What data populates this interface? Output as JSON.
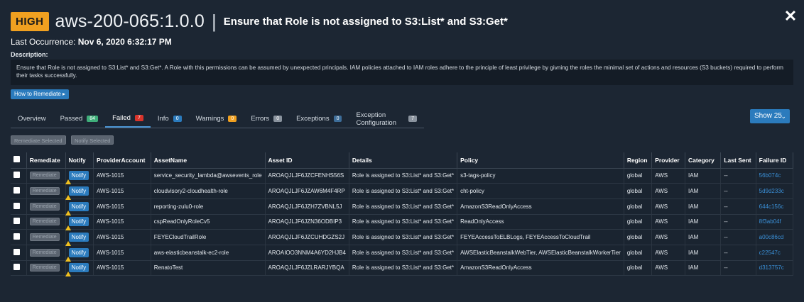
{
  "header": {
    "severity": "HIGH",
    "rule_id": "aws-200-065:1.0.0",
    "separator": "|",
    "title": "Ensure that Role is not assigned to S3:List* and S3:Get*",
    "close_icon": "close-icon",
    "last_occurrence_label": "Last Occurrence:",
    "last_occurrence_value": "Nov 6, 2020 6:32:17 PM"
  },
  "description": {
    "label": "Description:",
    "text": "Ensure that Role is not assigned to S3:List* and S3:Get*. A Role with this permissions can be assumed by unexpected principals. IAM policies attached to IAM roles adhere to the principle of least privilege by givning the roles the minimal set of actions and resources (S3 buckets) required to perform their tasks successfully."
  },
  "how_to_remediate": "How to Remediate ▸",
  "tabs": [
    {
      "label": "Overview",
      "count": "",
      "color": ""
    },
    {
      "label": "Passed",
      "count": "84",
      "color": "#3fae7a"
    },
    {
      "label": "Failed",
      "count": "7",
      "color": "#d9342b"
    },
    {
      "label": "Info",
      "count": "0",
      "color": "#2b7bbd"
    },
    {
      "label": "Warnings",
      "count": "0",
      "color": "#f0a020"
    },
    {
      "label": "Errors",
      "count": "0",
      "color": "#8a939e"
    },
    {
      "label": "Exceptions",
      "count": "0",
      "color": "#3d6d99"
    },
    {
      "label": "Exception Configuration",
      "count": "7",
      "color": "#8a939e"
    }
  ],
  "active_tab": "Failed",
  "show_select": {
    "label": "Show 25",
    "icon": "chevron-down-icon"
  },
  "bulk": {
    "remediate_selected": "Remediate Selected",
    "notify_selected": "Notify Selected"
  },
  "table": {
    "headers": [
      "",
      "Remediate",
      "Notify",
      "ProviderAccount",
      "AssetName",
      "Asset ID",
      "Details",
      "Policy",
      "Region",
      "Provider",
      "Category",
      "Last Sent",
      "Failure ID"
    ],
    "remediate_label": "Remediate",
    "notify_label": "Notify",
    "rows": [
      {
        "account": "AWS-1015",
        "asset_name": "service_security_lambda@awsevents_role",
        "asset_id": "AROAQJLJF6JZCFENHS56S",
        "details": "Role is assigned to S3:List* and S3:Get*",
        "policy": "s3-tags-policy",
        "region": "global",
        "provider": "AWS",
        "category": "IAM",
        "last_sent": "--",
        "failure_id": "56b074c"
      },
      {
        "account": "AWS-1015",
        "asset_name": "cloudvisory2-cloudhealth-role",
        "asset_id": "AROAQJLJF6JZAW6M4F4RP",
        "details": "Role is assigned to S3:List* and S3:Get*",
        "policy": "cht-policy",
        "region": "global",
        "provider": "AWS",
        "category": "IAM",
        "last_sent": "--",
        "failure_id": "5d9d233c"
      },
      {
        "account": "AWS-1015",
        "asset_name": "reporting-zulu0-role",
        "asset_id": "AROAQJLJF6JZH7ZVBNL5J",
        "details": "Role is assigned to S3:List* and S3:Get*",
        "policy": "AmazonS3ReadOnlyAccess",
        "region": "global",
        "provider": "AWS",
        "category": "IAM",
        "last_sent": "--",
        "failure_id": "644c156c"
      },
      {
        "account": "AWS-1015",
        "asset_name": "cspReadOnlyRoleCv5",
        "asset_id": "AROAQJLJF6JZN36ODBIP3",
        "details": "Role is assigned to S3:List* and S3:Get*",
        "policy": "ReadOnlyAccess",
        "region": "global",
        "provider": "AWS",
        "category": "IAM",
        "last_sent": "--",
        "failure_id": "8f3ab04f"
      },
      {
        "account": "AWS-1015",
        "asset_name": "FEYECloudTrailRole",
        "asset_id": "AROAQJLJF6JZCUHDGZS2J",
        "details": "Role is assigned to S3:List* and S3:Get*",
        "policy": "FEYEAccessToELBLogs, FEYEAccessToCloudTrail",
        "region": "global",
        "provider": "AWS",
        "category": "IAM",
        "last_sent": "--",
        "failure_id": "a00c86cd"
      },
      {
        "account": "AWS-1015",
        "asset_name": "aws-elasticbeanstalk-ec2-role",
        "asset_id": "AROAIOO3NNM4A6YD2HJB4",
        "details": "Role is assigned to S3:List* and S3:Get*",
        "policy": "AWSElasticBeanstalkWebTier, AWSElasticBeanstalkWorkerTier",
        "region": "global",
        "provider": "AWS",
        "category": "IAM",
        "last_sent": "--",
        "failure_id": "c22547c"
      },
      {
        "account": "AWS-1015",
        "asset_name": "RenatoTest",
        "asset_id": "AROAQJLJF6JZLRARJYBQA",
        "details": "Role is assigned to S3:List* and S3:Get*",
        "policy": "AmazonS3ReadOnlyAccess",
        "region": "global",
        "provider": "AWS",
        "category": "IAM",
        "last_sent": "--",
        "failure_id": "d313757c"
      }
    ]
  }
}
